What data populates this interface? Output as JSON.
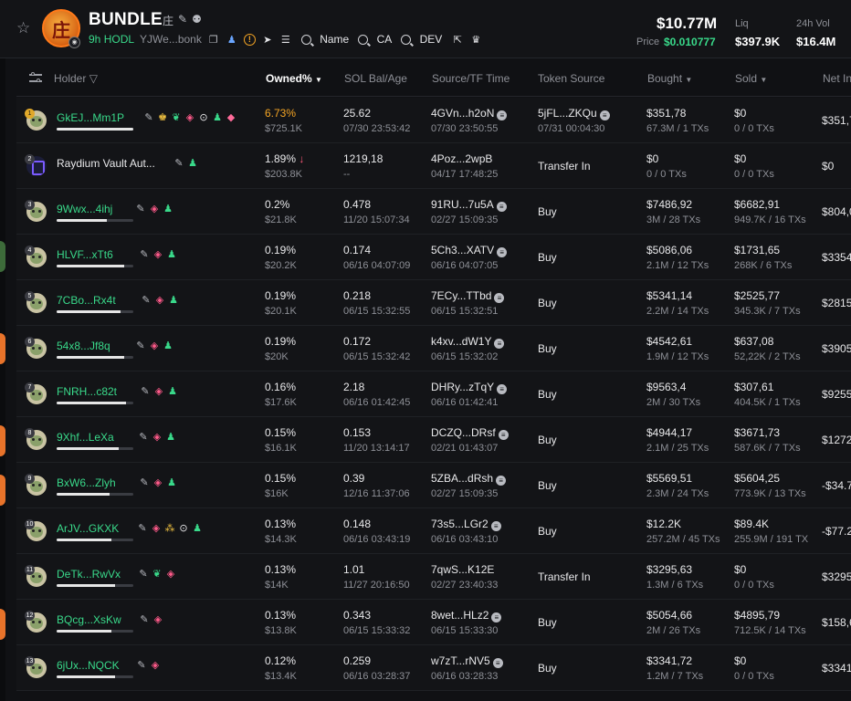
{
  "header": {
    "token_name": "BUNDLE",
    "token_avatar_glyph": "庄",
    "name_icons": [
      "庄",
      "✎",
      "⚉"
    ],
    "age": "9h",
    "hodl_label": "HODL",
    "address": "YJWe...bonk",
    "search_chips": [
      "Name",
      "CA",
      "DEV"
    ],
    "market_cap": "$10.77M",
    "price_label": "Price",
    "price": "$0.010777",
    "liq_label": "Liq",
    "liq": "$397.9K",
    "vol_label": "24h Vol",
    "vol": "$16.4M"
  },
  "columns": {
    "holder": "Holder",
    "owned": "Owned%",
    "sol": "SOL Bal/Age",
    "source": "Source/TF Time",
    "token_source": "Token Source",
    "bought": "Bought",
    "sold": "Sold",
    "net": "Net In"
  },
  "rows": [
    {
      "rank": "1",
      "holder": "GkEJ...Mm1P",
      "pct": "6.73%",
      "usd": "$725.1K",
      "sol": "25.62",
      "age": "07/30 23:53:42",
      "src": "4GVn...h2oN",
      "src_time": "07/30 23:50:55",
      "tsrc": "5jFL...ZKQu",
      "tsrc_time": "07/31 00:04:30",
      "bought": "$351,78",
      "bought_sub": "67.3M / 1 TXs",
      "sold": "$0",
      "sold_sub": "0 / 0 TXs",
      "net": "$351,7"
    },
    {
      "rank": "2",
      "holder": "Raydium Vault Aut...",
      "pct": "1.89%",
      "usd": "$203.8K",
      "sol": "1219,18",
      "age": "--",
      "src": "4Poz...2wpB",
      "src_time": "04/17 17:48:25",
      "tsrc": "Transfer In",
      "bought": "$0",
      "bought_sub": "0 / 0 TXs",
      "sold": "$0",
      "sold_sub": "0 / 0 TXs",
      "net": "$0"
    },
    {
      "rank": "3",
      "holder": "9Wwx...4ihj",
      "pct": "0.2%",
      "usd": "$21.8K",
      "sol": "0.478",
      "age": "11/20 15:07:34",
      "src": "91RU...7u5A",
      "src_time": "02/27 15:09:35",
      "tsrc": "Buy",
      "bought": "$7486,92",
      "bought_sub": "3M / 28 TXs",
      "sold": "$6682,91",
      "sold_sub": "949.7K / 16 TXs",
      "net": "$804,0"
    },
    {
      "rank": "4",
      "holder": "HLVF...xTt6",
      "pct": "0.19%",
      "usd": "$20.2K",
      "sol": "0.174",
      "age": "06/16 04:07:09",
      "src": "5Ch3...XATV",
      "src_time": "06/16 04:07:05",
      "tsrc": "Buy",
      "bought": "$5086,06",
      "bought_sub": "2.1M / 12 TXs",
      "sold": "$1731,65",
      "sold_sub": "268K / 6 TXs",
      "net": "$3354"
    },
    {
      "rank": "5",
      "holder": "7CBo...Rx4t",
      "pct": "0.19%",
      "usd": "$20.1K",
      "sol": "0.218",
      "age": "06/15 15:32:55",
      "src": "7ECy...TTbd",
      "src_time": "06/15 15:32:51",
      "tsrc": "Buy",
      "bought": "$5341,14",
      "bought_sub": "2.2M / 14 TXs",
      "sold": "$2525,77",
      "sold_sub": "345.3K / 7 TXs",
      "net": "$2815"
    },
    {
      "rank": "6",
      "holder": "54x8...Jf8q",
      "pct": "0.19%",
      "usd": "$20K",
      "sol": "0.172",
      "age": "06/15 15:32:42",
      "src": "k4xv...dW1Y",
      "src_time": "06/15 15:32:02",
      "tsrc": "Buy",
      "bought": "$4542,61",
      "bought_sub": "1.9M / 12 TXs",
      "sold": "$637,08",
      "sold_sub": "52,22K / 2 TXs",
      "net": "$3905"
    },
    {
      "rank": "7",
      "holder": "FNRH...c82t",
      "pct": "0.16%",
      "usd": "$17.6K",
      "sol": "2.18",
      "age": "06/16 01:42:45",
      "src": "DHRy...zTqY",
      "src_time": "06/16 01:42:41",
      "tsrc": "Buy",
      "bought": "$9563,4",
      "bought_sub": "2M / 30 TXs",
      "sold": "$307,61",
      "sold_sub": "404.5K / 1 TXs",
      "net": "$9255"
    },
    {
      "rank": "8",
      "holder": "9Xhf...LeXa",
      "pct": "0.15%",
      "usd": "$16.1K",
      "sol": "0.153",
      "age": "11/20 13:14:17",
      "src": "DCZQ...DRsf",
      "src_time": "02/21 01:43:07",
      "tsrc": "Buy",
      "bought": "$4944,17",
      "bought_sub": "2.1M / 25 TXs",
      "sold": "$3671,73",
      "sold_sub": "587.6K / 7 TXs",
      "net": "$1272"
    },
    {
      "rank": "9",
      "holder": "BxW6...Zlyh",
      "pct": "0.15%",
      "usd": "$16K",
      "sol": "0.39",
      "age": "12/16 11:37:06",
      "src": "5ZBA...dRsh",
      "src_time": "02/27 15:09:35",
      "tsrc": "Buy",
      "bought": "$5569,51",
      "bought_sub": "2.3M / 24 TXs",
      "sold": "$5604,25",
      "sold_sub": "773.9K / 13 TXs",
      "net": "-$34.7"
    },
    {
      "rank": "10",
      "holder": "ArJV...GKXK",
      "pct": "0.13%",
      "usd": "$14.3K",
      "sol": "0.148",
      "age": "06/16 03:43:19",
      "src": "73s5...LGr2",
      "src_time": "06/16 03:43:10",
      "tsrc": "Buy",
      "bought": "$12.2K",
      "bought_sub": "257.2M / 45 TXs",
      "sold": "$89.4K",
      "sold_sub": "255.9M / 191 TX",
      "net": "-$77.2"
    },
    {
      "rank": "11",
      "holder": "DeTk...RwVx",
      "pct": "0.13%",
      "usd": "$14K",
      "sol": "1.01",
      "age": "11/27 20:16:50",
      "src": "7qwS...K12E",
      "src_time": "02/27 23:40:33",
      "tsrc": "Transfer In",
      "bought": "$3295,63",
      "bought_sub": "1.3M / 6 TXs",
      "sold": "$0",
      "sold_sub": "0 / 0 TXs",
      "net": "$3295"
    },
    {
      "rank": "12",
      "holder": "BQcg...XsKw",
      "pct": "0.13%",
      "usd": "$13.8K",
      "sol": "0.343",
      "age": "06/15 15:33:32",
      "src": "8wet...HLz2",
      "src_time": "06/15 15:33:30",
      "tsrc": "Buy",
      "bought": "$5054,66",
      "bought_sub": "2M / 26 TXs",
      "sold": "$4895,79",
      "sold_sub": "712.5K / 14 TXs",
      "net": "$158,6"
    },
    {
      "rank": "13",
      "holder": "6jUx...NQCK",
      "pct": "0.12%",
      "usd": "$13.4K",
      "sol": "0.259",
      "age": "06/16 03:28:37",
      "src": "w7zT...rNV5",
      "src_time": "06/16 03:28:33",
      "tsrc": "Buy",
      "bought": "$3341,72",
      "bought_sub": "1.2M / 7 TXs",
      "sold": "$0",
      "sold_sub": "0 / 0 TXs",
      "net": "$3341"
    }
  ]
}
